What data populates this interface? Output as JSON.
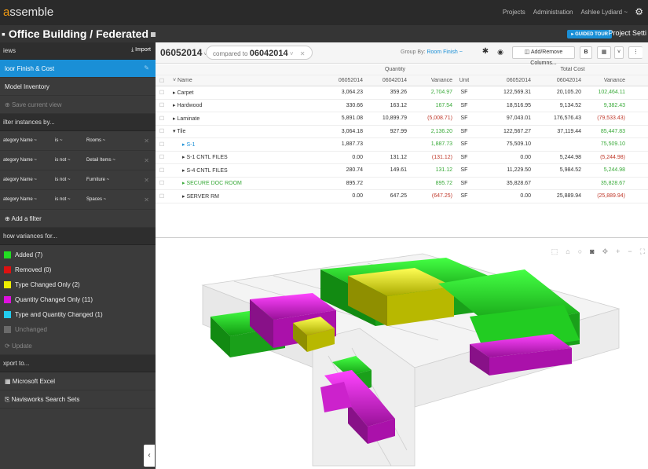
{
  "app": {
    "logo_prefix": "a",
    "logo_rest": "ssemble"
  },
  "topnav": {
    "projects": "Projects",
    "administration": "Administration",
    "user": "Ashlee Lydiard ~"
  },
  "project": {
    "title": "Office Building / Federated",
    "guided_tour": "▸ GUIDED TOUR",
    "project_settings": "Project Setti"
  },
  "sidebar": {
    "views_label": "iews",
    "import_label": "Import",
    "views": [
      {
        "label": "loor Finish & Cost"
      },
      {
        "label": "Model Inventory"
      },
      {
        "label": "Save current view"
      }
    ],
    "filter_header": "ilter instances by...",
    "filters": [
      {
        "field": "ategory Name ~",
        "op": "is ~",
        "value": "Rooms ~"
      },
      {
        "field": "ategory Name ~",
        "op": "is not ~",
        "value": "Detail Items ~"
      },
      {
        "field": "ategory Name ~",
        "op": "is not ~",
        "value": "Furniture ~"
      },
      {
        "field": "ategory Name ~",
        "op": "is not ~",
        "value": "Spaces ~"
      }
    ],
    "add_filter": "Add a filter",
    "variance_header": "how variances for...",
    "legend": [
      {
        "label": "Added (7)",
        "color": "#22dd22"
      },
      {
        "label": "Removed (0)",
        "color": "#dd1111"
      },
      {
        "label": "Type Changed Only (2)",
        "color": "#eeee00"
      },
      {
        "label": "Quantity Changed Only (11)",
        "color": "#dd11dd"
      },
      {
        "label": "Type and Quantity Changed (1)",
        "color": "#22ccee"
      },
      {
        "label": "Unchanged",
        "color": "#8a8a8a"
      }
    ],
    "update": "Update",
    "export_header": "xport to...",
    "export": [
      "Microsoft Excel",
      "Navisworks Search Sets"
    ]
  },
  "toolbar": {
    "snapshot": "06052014",
    "compared_to": "compared to",
    "compare_snapshot": "06042014",
    "group_by": "Group By:",
    "group_value": "Room Finish ~",
    "add_remove": "Add/Remove Columns..."
  },
  "table": {
    "group_quantity": "Quantity",
    "group_total": "Total Cost",
    "headers": [
      "Name",
      "06052014",
      "06042014",
      "Variance",
      "Unit",
      "06052014",
      "06042014",
      "Variance"
    ],
    "rows": [
      {
        "name": "▸ Carpet",
        "q1": "3,064.23",
        "q2": "359.26",
        "var": "2,704.97",
        "var_sign": "pos",
        "unit": "SF",
        "t1": "122,569.31",
        "t2": "20,105.20",
        "tv": "102,464.11",
        "tv_sign": "pos",
        "sub": false
      },
      {
        "name": "▸ Hardwood",
        "q1": "330.66",
        "q2": "163.12",
        "var": "167.54",
        "var_sign": "pos",
        "unit": "SF",
        "t1": "18,516.95",
        "t2": "9,134.52",
        "tv": "9,382.43",
        "tv_sign": "pos",
        "sub": false
      },
      {
        "name": "▸ Laminate",
        "q1": "5,891.08",
        "q2": "10,899.79",
        "var": "(5,008.71)",
        "var_sign": "neg",
        "unit": "SF",
        "t1": "97,043.01",
        "t2": "176,576.43",
        "tv": "(79,533.43)",
        "tv_sign": "neg",
        "sub": false
      },
      {
        "name": "▾ Tile",
        "q1": "3,064.18",
        "q2": "927.99",
        "var": "2,136.20",
        "var_sign": "pos",
        "unit": "SF",
        "t1": "122,567.27",
        "t2": "37,119.44",
        "tv": "85,447.83",
        "tv_sign": "pos",
        "sub": false
      },
      {
        "name": "▸ S-1",
        "q1": "1,887.73",
        "q2": "",
        "var": "1,887.73",
        "var_sign": "pos",
        "unit": "SF",
        "t1": "75,509.10",
        "t2": "",
        "tv": "75,509.10",
        "tv_sign": "pos",
        "sub": true,
        "name_color": "blue"
      },
      {
        "name": "▸ S-1 CNTL FILES",
        "q1": "0.00",
        "q2": "131.12",
        "var": "(131.12)",
        "var_sign": "neg",
        "unit": "SF",
        "t1": "0.00",
        "t2": "5,244.98",
        "tv": "(5,244.98)",
        "tv_sign": "neg",
        "sub": true
      },
      {
        "name": "▸ S-4 CNTL FILES",
        "q1": "280.74",
        "q2": "149.61",
        "var": "131.12",
        "var_sign": "pos",
        "unit": "SF",
        "t1": "11,229.50",
        "t2": "5,984.52",
        "tv": "5,244.98",
        "tv_sign": "pos",
        "sub": true
      },
      {
        "name": "▸ SECURE DOC ROOM",
        "q1": "895.72",
        "q2": "",
        "var": "895.72",
        "var_sign": "pos",
        "unit": "SF",
        "t1": "35,828.67",
        "t2": "",
        "tv": "35,828.67",
        "tv_sign": "pos",
        "sub": true,
        "name_color": "pos"
      },
      {
        "name": "▸ SERVER RM",
        "q1": "0.00",
        "q2": "647.25",
        "var": "(647.25)",
        "var_sign": "neg",
        "unit": "SF",
        "t1": "0.00",
        "t2": "25,889.94",
        "tv": "(25,889.94)",
        "tv_sign": "neg",
        "sub": true
      }
    ]
  },
  "colors": {
    "accent": "#1a8fd6",
    "added": "#22dd22",
    "type_changed": "#eeee00",
    "quantity_changed": "#dd11dd"
  }
}
